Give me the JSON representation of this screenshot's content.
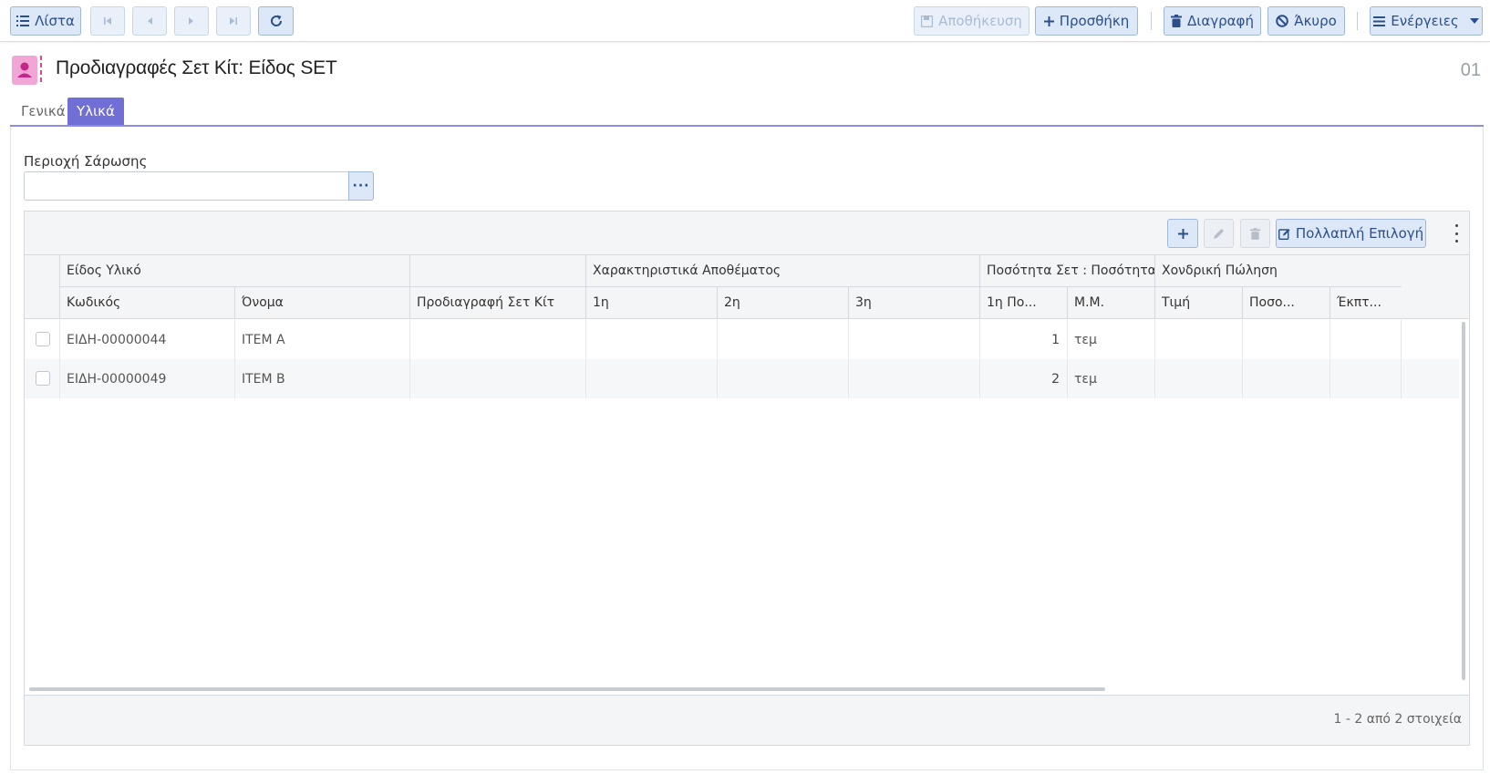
{
  "toolbar": {
    "list_label": "Λίστα",
    "save_label": "Αποθήκευση",
    "add_label": "Προσθήκη",
    "delete_label": "Διαγραφή",
    "cancel_label": "Άκυρο",
    "actions_label": "Ενέργειες"
  },
  "header": {
    "title": "Προδιαγραφές Σετ Κίτ: Είδος SET",
    "record_number": "01"
  },
  "tabs": [
    {
      "label": "Γενικά",
      "active": false
    },
    {
      "label": "Υλικά",
      "active": true
    }
  ],
  "scan": {
    "label": "Περιοχή Σάρωσης",
    "value": "",
    "button_label": "···"
  },
  "grid": {
    "multi_select_label": "Πολλαπλή Επιλογή",
    "group_headers": {
      "material_item": "Είδος Υλικό",
      "stock_characteristics": "Χαρακτηριστικά Αποθέματος",
      "set_quantity": "Ποσότητα Σετ : Ποσότητα ...",
      "retail_sale": "Χονδρική Πώληση"
    },
    "columns": {
      "code": "Κωδικός",
      "name": "Όνομα",
      "kit_spec": "Προδιαγραφή Σετ Κίτ",
      "first": "1η",
      "second": "2η",
      "third": "3η",
      "first_qty": "1η Πο...",
      "unit": "Μ.Μ.",
      "price": "Τιμή",
      "percent": "Ποσο...",
      "discount": "Έκπτ..."
    },
    "rows": [
      {
        "code": "ΕΙΔΗ-00000044",
        "name": "ITEM A",
        "kit_spec": "",
        "first": "",
        "second": "",
        "third": "",
        "qty": "1",
        "unit": "τεμ",
        "price": "",
        "percent": "",
        "discount": ""
      },
      {
        "code": "ΕΙΔΗ-00000049",
        "name": "ITEM B",
        "kit_spec": "",
        "first": "",
        "second": "",
        "third": "",
        "qty": "2",
        "unit": "τεμ",
        "price": "",
        "percent": "",
        "discount": ""
      }
    ],
    "pager_info": "1 - 2 από 2 στοιχεία"
  },
  "colors": {
    "accent": "#6f6fd6",
    "button_bg": "#dce8f7",
    "button_text": "#2a4f8a",
    "icon_pink": "#f2a6d6"
  }
}
